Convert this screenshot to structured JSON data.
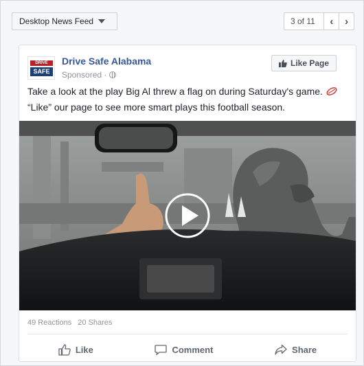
{
  "header": {
    "feed_selector": "Desktop News Feed",
    "pager_count": "3 of 11",
    "prev_label": "‹",
    "next_label": "›"
  },
  "post": {
    "page_name": "Drive Safe Alabama",
    "sponsored_label": "Sponsored ·",
    "logo_text_top": "DRIVE",
    "logo_text_bottom": "SAFE",
    "like_page_label": "Like Page",
    "text_line1": "Take a look at the play Big Al threw a flag on during Saturday's game.",
    "text_line2": "“Like” our page to see more smart plays this football season.",
    "reactions": "49 Reactions",
    "shares": "20 Shares",
    "actions": {
      "like": "Like",
      "comment": "Comment",
      "share": "Share"
    }
  },
  "colors": {
    "link_blue": "#365899",
    "meta_gray": "#90949c",
    "action_gray": "#606770"
  },
  "icons": [
    "chevron-down-icon",
    "chevron-left-icon",
    "chevron-right-icon",
    "globe-icon",
    "thumbs-up-icon",
    "football-icon",
    "play-icon",
    "comment-icon",
    "share-icon"
  ]
}
